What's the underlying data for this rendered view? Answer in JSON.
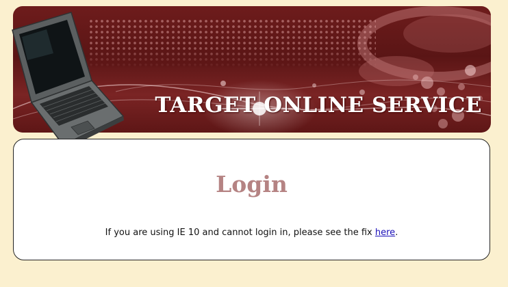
{
  "banner": {
    "title": "TARGET ONLINE SERVICE",
    "image": "laptop-icon"
  },
  "login": {
    "heading": "Login",
    "notice_text": "If you are using IE 10 and cannot login in, please see the fix ",
    "notice_link": "here",
    "notice_end": "."
  },
  "colors": {
    "page_background": "#fbf0cf",
    "banner_maroon": "#6e1c1c",
    "heading": "#b58383",
    "link": "#1a0fb8"
  }
}
